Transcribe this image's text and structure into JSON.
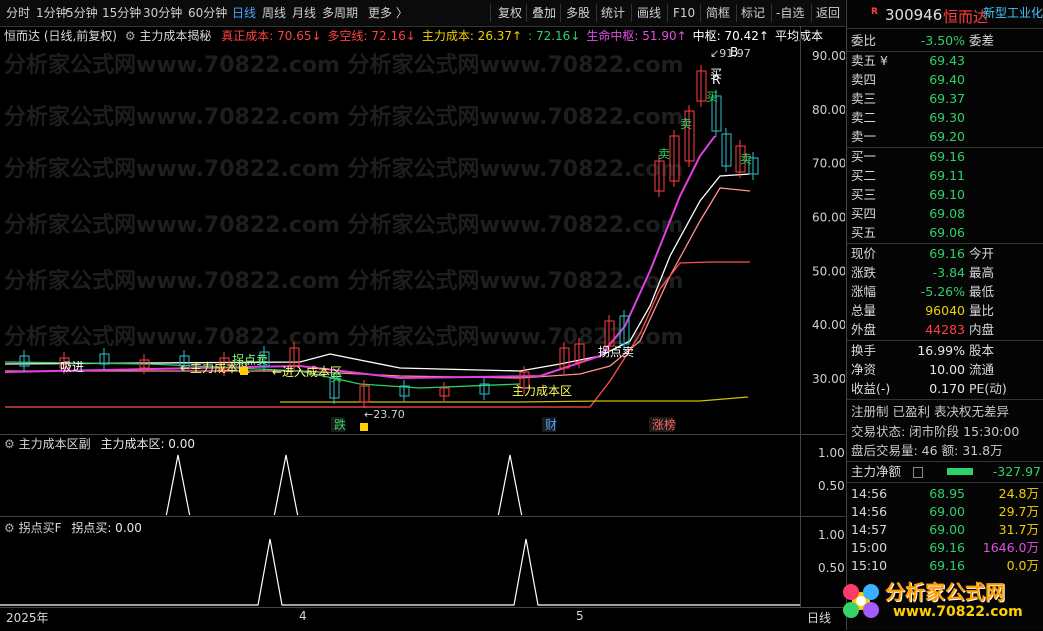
{
  "toolbar": {
    "periods": [
      "分时",
      "1分钟",
      "5分钟",
      "15分钟",
      "30分钟",
      "60分钟",
      "日线",
      "周线",
      "月线",
      "多周期",
      "更多 〉"
    ],
    "active_period": "日线",
    "tools": [
      "复权",
      "叠加",
      "多股",
      "统计",
      "画线",
      "F10",
      "简框",
      "标记",
      "-自选",
      "返回"
    ]
  },
  "main_title": {
    "stock": "恒而达 (日线,前复权)",
    "indicator": "主力成本揭秘",
    "items": [
      {
        "label": "真正成本: 70.65",
        "arrow": "↓",
        "color": "#ff4040"
      },
      {
        "label": "多空线: 72.16",
        "arrow": "↓",
        "color": "#ff4040"
      },
      {
        "label": "主力成本: 26.37",
        "arrow": "↑",
        "color": "#f0d000"
      },
      {
        "label": ": 72.16",
        "arrow": "↓",
        "color": "#2fd06a"
      },
      {
        "label": "生命中枢: 51.90",
        "arrow": "↑",
        "color": "#e050e0"
      },
      {
        "label": "中枢: 70.42",
        "arrow": "↑",
        "color": "#ffffff"
      },
      {
        "label": "平均成本",
        "arrow": "",
        "color": "#ffffff"
      }
    ]
  },
  "price_axis": [
    "90.00",
    "80.00",
    "70.00",
    "60.00",
    "50.00",
    "40.00",
    "30.00"
  ],
  "annotations": {
    "high": "91.97",
    "low": "←23.70",
    "labels": [
      "吸进",
      "←主力成本区",
      "拐点卖",
      "←进入成本区",
      "卖",
      "拐点卖",
      "主力成本区",
      "卖",
      "卖",
      "买",
      "买",
      "卖",
      "R",
      "B"
    ],
    "events": [
      "跌",
      "财",
      "涨榜"
    ]
  },
  "sub1": {
    "title": "主力成本区副",
    "value_label": "主力成本区: 0.00",
    "axis": [
      "1.00",
      "0.50"
    ]
  },
  "sub2": {
    "title": "拐点买F",
    "value_label": "拐点买: 0.00",
    "axis": [
      "1.00",
      "0.50"
    ]
  },
  "time_axis": {
    "labels": [
      "2025年",
      "4",
      "5"
    ],
    "period_btn": "日线"
  },
  "watermark": "分析家公式网www.70822.com",
  "quote": {
    "badge": "R",
    "code": "300946",
    "name": "恒而达",
    "sector": "新型工业化",
    "weibi_label": "委比",
    "weibi": "-3.50%",
    "weicha_label": "委差",
    "asks": [
      {
        "label": "卖五 ¥",
        "price": "69.43"
      },
      {
        "label": "卖四",
        "price": "69.40"
      },
      {
        "label": "卖三",
        "price": "69.37"
      },
      {
        "label": "卖二",
        "price": "69.30"
      },
      {
        "label": "卖一",
        "price": "69.20"
      }
    ],
    "bids": [
      {
        "label": "买一",
        "price": "69.16"
      },
      {
        "label": "买二",
        "price": "69.11"
      },
      {
        "label": "买三",
        "price": "69.10"
      },
      {
        "label": "买四",
        "price": "69.08"
      },
      {
        "label": "买五",
        "price": "69.06"
      }
    ],
    "stats": [
      {
        "l1": "现价",
        "v": "69.16",
        "c": "green",
        "l2": "今开"
      },
      {
        "l1": "涨跌",
        "v": "-3.84",
        "c": "green",
        "l2": "最高"
      },
      {
        "l1": "涨幅",
        "v": "-5.26%",
        "c": "green",
        "l2": "最低"
      },
      {
        "l1": "总量",
        "v": "96040",
        "c": "yellow",
        "l2": "量比"
      },
      {
        "l1": "外盘",
        "v": "44283",
        "c": "red",
        "l2": "内盘"
      }
    ],
    "stats2": [
      {
        "l1": "换手",
        "v": "16.99%",
        "l2": "股本"
      },
      {
        "l1": "净资",
        "v": "10.00",
        "l2": "流通"
      },
      {
        "l1": "收益(-)",
        "v": "0.170",
        "l2": "PE(动)"
      }
    ],
    "reg": "注册制 已盈利 表决权无差异",
    "trade_state": "交易状态: 闭市阶段 15:30:00",
    "after_hours": "盘后交易量: 46  额: 31.8万",
    "net_label": "主力净额",
    "net_value": "-327.97",
    "ticks": [
      {
        "t": "14:56",
        "p": "68.95",
        "v": "24.8万",
        "pc": "green",
        "vc": "yellow"
      },
      {
        "t": "14:56",
        "p": "69.00",
        "v": "29.7万",
        "pc": "green",
        "vc": "yellow"
      },
      {
        "t": "14:57",
        "p": "69.00",
        "v": "31.7万",
        "pc": "green",
        "vc": "yellow"
      },
      {
        "t": "15:00",
        "p": "69.16",
        "v": "1646.0万",
        "pc": "green",
        "vc": "mag"
      },
      {
        "t": "15:10",
        "p": "69.16",
        "v": "0.0万",
        "pc": "green",
        "vc": "yellow"
      }
    ]
  },
  "logo": {
    "text": "分析家公式网",
    "url": "www.70822.com"
  }
}
